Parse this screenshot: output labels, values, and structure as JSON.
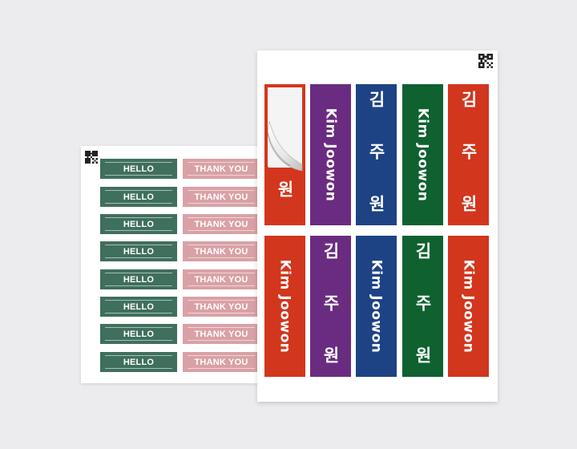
{
  "back_sheet": {
    "hello_text": "HELLO",
    "thank_you_text": "THANK YOU",
    "rows": 8,
    "colors": {
      "hello": "#3f6f5d",
      "thank_you": "#d9a1a6"
    }
  },
  "front_sheet": {
    "labels": [
      {
        "text": "원",
        "script": "ko",
        "color": "#d2361d",
        "peeled": true
      },
      {
        "text": "Kim Joowon",
        "script": "latin",
        "color": "#6a2c80"
      },
      {
        "text": "김 주 원",
        "script": "ko",
        "color": "#1e4384"
      },
      {
        "text": "Kim Joowon",
        "script": "latin",
        "color": "#0f6130"
      },
      {
        "text": "김 주 원",
        "script": "ko",
        "color": "#d2361d"
      },
      {
        "text": "Kim Joowon",
        "script": "latin",
        "color": "#d2361d"
      },
      {
        "text": "김 주 원",
        "script": "ko",
        "color": "#6a2c80"
      },
      {
        "text": "Kim Joowon",
        "script": "latin",
        "color": "#1e4384"
      },
      {
        "text": "김 주 원",
        "script": "ko",
        "color": "#0f6130"
      },
      {
        "text": "Kim Joowon",
        "script": "latin",
        "color": "#d2361d"
      }
    ]
  },
  "icons": [
    "qr-code-icon",
    "peel-corner-icon"
  ]
}
